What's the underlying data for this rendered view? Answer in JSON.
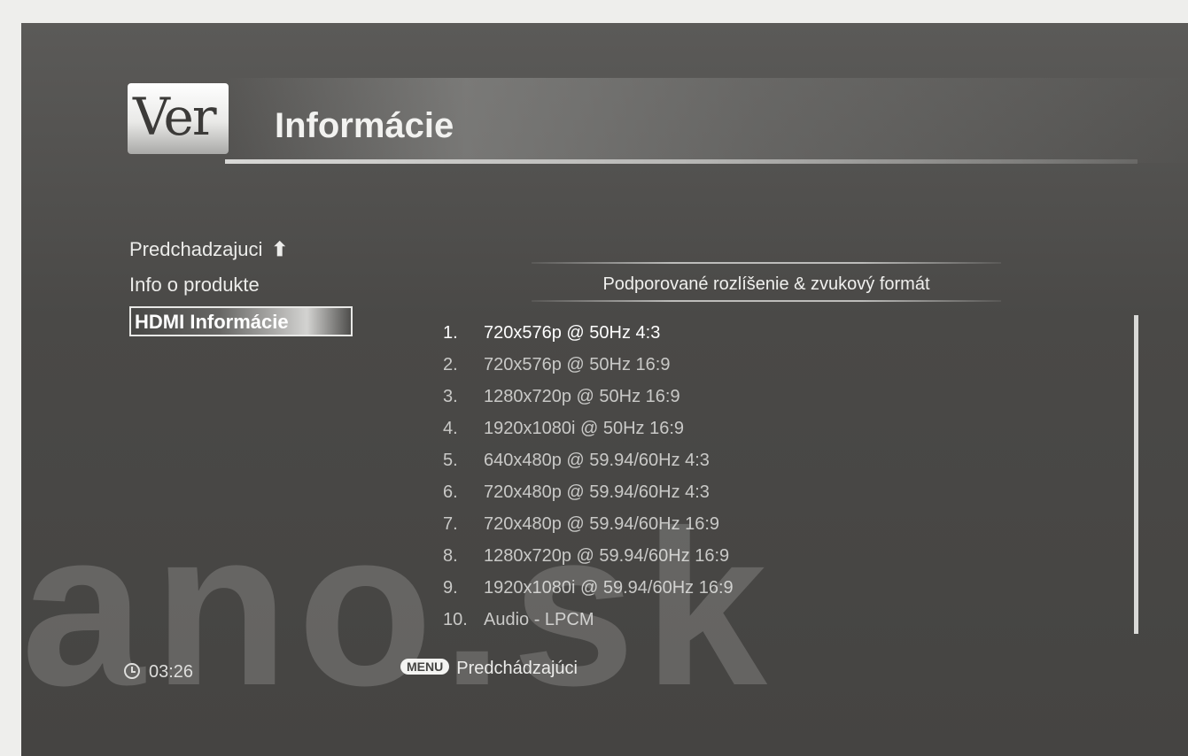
{
  "logo": {
    "text": "Ver"
  },
  "header": {
    "title": "Informácie"
  },
  "sidebar": {
    "items": [
      {
        "label": "Predchadzajuci",
        "arrow": "⬆"
      },
      {
        "label": "Info o produkte"
      },
      {
        "label": "HDMI Informácie"
      }
    ]
  },
  "main": {
    "section_title": "Podporované rozlíšenie & zvukový formát",
    "formats": [
      {
        "num": "1.",
        "text": "720x576p @ 50Hz 4:3"
      },
      {
        "num": "2.",
        "text": "720x576p @ 50Hz 16:9"
      },
      {
        "num": "3.",
        "text": "1280x720p @ 50Hz 16:9"
      },
      {
        "num": "4.",
        "text": "1920x1080i @ 50Hz 16:9"
      },
      {
        "num": "5.",
        "text": "640x480p @ 59.94/60Hz 4:3"
      },
      {
        "num": "6.",
        "text": "720x480p @ 59.94/60Hz 4:3"
      },
      {
        "num": "7.",
        "text": "720x480p @ 59.94/60Hz 16:9"
      },
      {
        "num": "8.",
        "text": "1280x720p @ 59.94/60Hz 16:9"
      },
      {
        "num": "9.",
        "text": "1920x1080i @ 59.94/60Hz 16:9"
      },
      {
        "num": "10.",
        "text": "Audio - LPCM"
      }
    ]
  },
  "watermark": {
    "text": "ano.sk"
  },
  "footer": {
    "clock_icon": "clock-icon",
    "time": "03:26",
    "menu_key": "MENU",
    "menu_label": "Predchádzajúci"
  }
}
